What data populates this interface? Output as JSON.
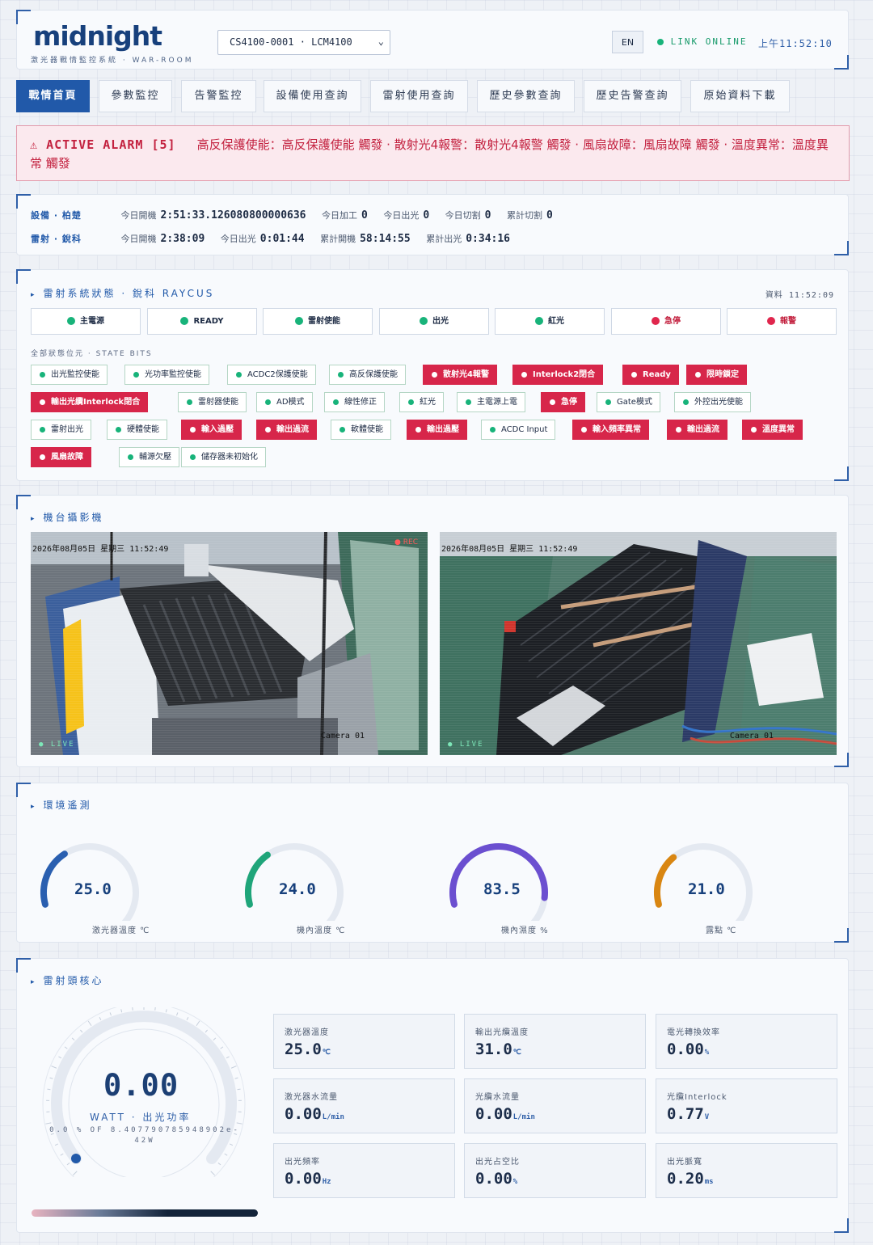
{
  "header": {
    "logo": "midnight",
    "subtitle": "激光器戰情監控系統 · WAR-ROOM",
    "device": "CS4100-0001 · LCM4100",
    "lang": "EN",
    "link_status": "LINK ONLINE",
    "clock": "上午11:52:10"
  },
  "tabs": [
    "戰情首頁",
    "參數監控",
    "告警監控",
    "設備使用查詢",
    "雷射使用查詢",
    "歷史參數查詢",
    "歷史告警查詢",
    "原始資料下載"
  ],
  "alarm": {
    "title": "ACTIVE ALARM [5]",
    "text": "高反保護使能：高反保護使能 觸發 · 散射光4報警：散射光4報警 觸發 · 風扇故障：風扇故障 觸發 · 溫度異常：溫度異常 觸發"
  },
  "equipment": {
    "device_label": "設備 · 柏楚",
    "device_items": [
      {
        "k": "今日開機",
        "v": "2:51:33.126080800000636"
      },
      {
        "k": "今日加工",
        "v": "0"
      },
      {
        "k": "今日出光",
        "v": "0"
      },
      {
        "k": "今日切割",
        "v": "0"
      },
      {
        "k": "累計切割",
        "v": "0"
      }
    ],
    "laser_label": "雷射 · 銳科",
    "laser_items": [
      {
        "k": "今日開機",
        "v": "2:38:09"
      },
      {
        "k": "今日出光",
        "v": "0:01:44"
      },
      {
        "k": "累計開機",
        "v": "58:14:55"
      },
      {
        "k": "累計出光",
        "v": "0:34:16"
      }
    ]
  },
  "laser_status": {
    "title": "雷射系統狀態 · 銳科 RAYCUS",
    "data_time": "資料 11:52:09",
    "status": [
      {
        "label": "主電源",
        "state": "ok"
      },
      {
        "label": "READY",
        "state": "ok"
      },
      {
        "label": "雷射使能",
        "state": "ok"
      },
      {
        "label": "出光",
        "state": "ok"
      },
      {
        "label": "紅光",
        "state": "ok"
      },
      {
        "label": "急停",
        "state": "alarm"
      },
      {
        "label": "報警",
        "state": "alarm"
      }
    ],
    "bits_title": "全部狀態位元 · STATE BITS",
    "bits": [
      {
        "label": "出光監控使能",
        "state": "ok"
      },
      {
        "label": "光功率監控使能",
        "state": "ok"
      },
      {
        "label": "ACDC2保護使能",
        "state": "ok"
      },
      {
        "label": "高反保護使能",
        "state": "ok"
      },
      {
        "label": "散射光4報警",
        "state": "alarm"
      },
      {
        "label": "Interlock2閉合",
        "state": "alarm"
      },
      {
        "label": "Ready",
        "state": "alarm"
      },
      {
        "label": "限時鎖定",
        "state": "alarm"
      },
      {
        "label": "輸出光纜Interlock閉合",
        "state": "alarm"
      },
      {
        "label": "雷射器使能",
        "state": "ok"
      },
      {
        "label": "AD模式",
        "state": "ok"
      },
      {
        "label": "線性修正",
        "state": "ok"
      },
      {
        "label": "紅光",
        "state": "ok"
      },
      {
        "label": "主電源上電",
        "state": "ok"
      },
      {
        "label": "急停",
        "state": "alarm"
      },
      {
        "label": "Gate模式",
        "state": "ok"
      },
      {
        "label": "外控出光使能",
        "state": "ok"
      },
      {
        "label": "雷射出光",
        "state": "ok"
      },
      {
        "label": "硬體使能",
        "state": "ok"
      },
      {
        "label": "輸入過壓",
        "state": "alarm"
      },
      {
        "label": "輸出過流",
        "state": "alarm"
      },
      {
        "label": "軟體使能",
        "state": "ok"
      },
      {
        "label": "輸出過壓",
        "state": "alarm"
      },
      {
        "label": "ACDC Input",
        "state": "ok"
      },
      {
        "label": "輸入頻率異常",
        "state": "alarm"
      },
      {
        "label": "輸出過流",
        "state": "alarm"
      },
      {
        "label": "溫度異常",
        "state": "alarm"
      },
      {
        "label": "風扇故障",
        "state": "alarm"
      },
      {
        "label": "輔源欠壓",
        "state": "ok"
      },
      {
        "label": "儲存器未初始化",
        "state": "ok"
      }
    ]
  },
  "cameras": {
    "title": "機台攝影機",
    "feeds": [
      {
        "timestamp": "2026年08月05日 星期三 11:52:49",
        "rec": "● REC",
        "name": "Camera 01",
        "live": "● LIVE"
      },
      {
        "timestamp": "2026年08月05日 星期三 11:52:49",
        "rec": "",
        "name": "Camera 01",
        "live": "● LIVE"
      }
    ]
  },
  "environment": {
    "title": "環境遙測",
    "gauges": [
      {
        "value": "25.0",
        "label": "激光器溫度 ℃",
        "fraction": 0.3,
        "color": "#2a5fb0"
      },
      {
        "value": "24.0",
        "label": "機內溫度 ℃",
        "fraction": 0.29,
        "color": "#1fa57a"
      },
      {
        "value": "83.5",
        "label": "機內濕度 %",
        "fraction": 0.84,
        "color": "#6b4fd0"
      },
      {
        "value": "21.0",
        "label": "露點 ℃",
        "fraction": 0.27,
        "color": "#d98612"
      }
    ]
  },
  "laser_head": {
    "title": "雷射頭核心",
    "power": "0.00",
    "power_label": "WATT · 出光功率",
    "power_sub": "0.0 % OF 8.407790785948902e-42W",
    "metrics": [
      {
        "k": "激光器溫度",
        "v": "25.0",
        "u": "℃"
      },
      {
        "k": "輸出光纜溫度",
        "v": "31.0",
        "u": "℃"
      },
      {
        "k": "電光轉換效率",
        "v": "0.00",
        "u": "%"
      },
      {
        "k": "激光器水流量",
        "v": "0.00",
        "u": "L/min"
      },
      {
        "k": "光纜水流量",
        "v": "0.00",
        "u": "L/min"
      },
      {
        "k": "光纜Interlock",
        "v": "0.77",
        "u": "V"
      },
      {
        "k": "出光頻率",
        "v": "0.00",
        "u": "Hz"
      },
      {
        "k": "出光占空比",
        "v": "0.00",
        "u": "%"
      },
      {
        "k": "出光脈寬",
        "v": "0.20",
        "u": "ms"
      }
    ]
  }
}
